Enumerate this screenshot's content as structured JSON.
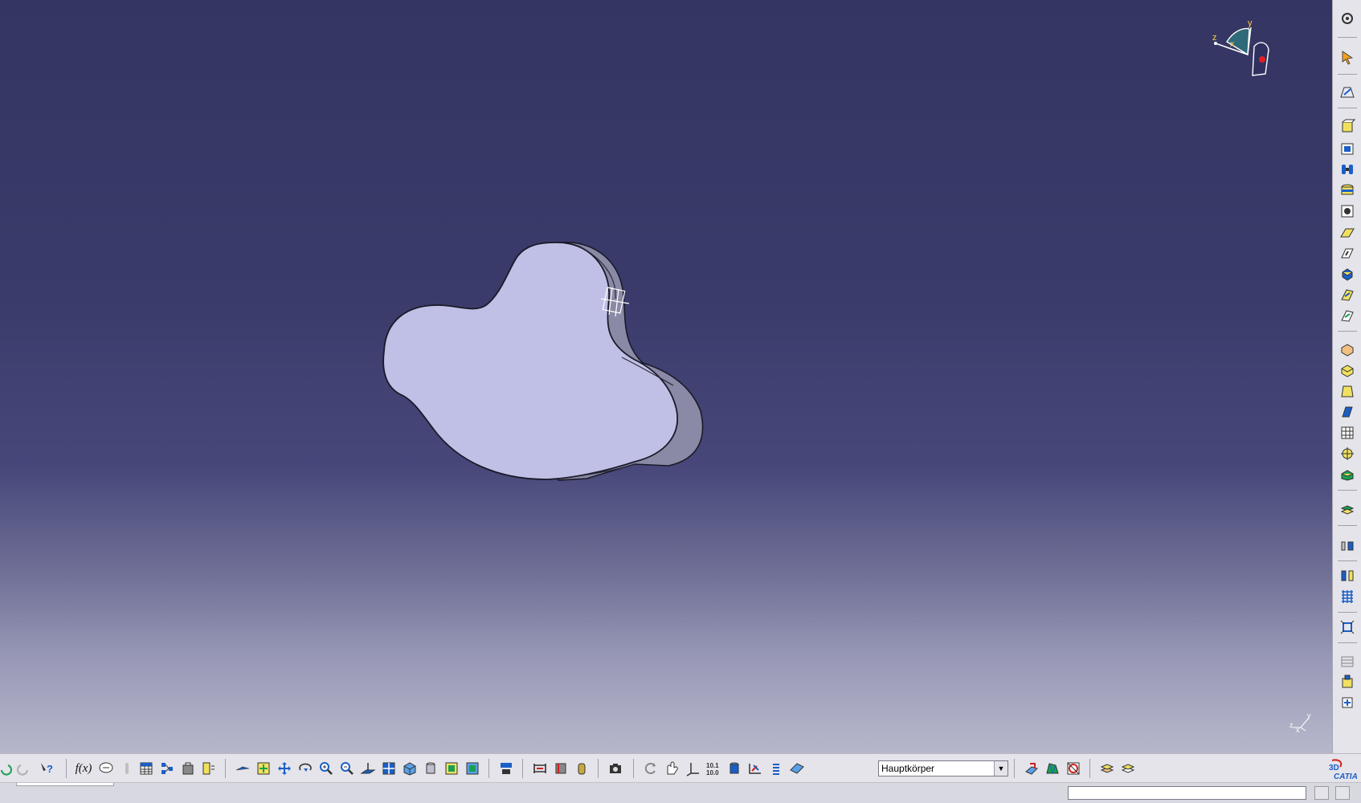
{
  "viewport": {
    "background_top": "#353563",
    "background_bottom": "#b7b7cb",
    "part_face_color": "#c0c0e6",
    "part_side_color": "#8a8aa6"
  },
  "compass": {
    "axis_x": "x",
    "axis_y": "y",
    "axis_z": "z"
  },
  "mini_axis": {
    "axis_x": "x",
    "axis_y": "y",
    "axis_z": "z"
  },
  "right_toolbar": {
    "items": [
      "settings-icon",
      "select-arrow-icon",
      "sketch-icon",
      "pad-icon",
      "pocket-icon",
      "shaft-icon",
      "groove-icon",
      "hole-icon",
      "rib-icon",
      "slot-icon",
      "stiffener-icon",
      "multi-section-solid-icon",
      "removed-multi-section-icon",
      "edge-fillet-icon",
      "chamfer-icon",
      "draft-icon",
      "shell-icon",
      "thickness-icon",
      "thread-icon",
      "remove-face-icon",
      "split-icon",
      "thick-surface-icon",
      "translation-icon",
      "mirror-icon",
      "rectangular-pattern-icon",
      "scaling-icon",
      "boolean-icon",
      "insert-body-icon"
    ]
  },
  "bottom_toolbar": {
    "formula_label": "f(x)",
    "current_body": "Hauptkörper",
    "accent_color": "#1a5fc8"
  },
  "status_bar": {
    "command_value": ""
  }
}
